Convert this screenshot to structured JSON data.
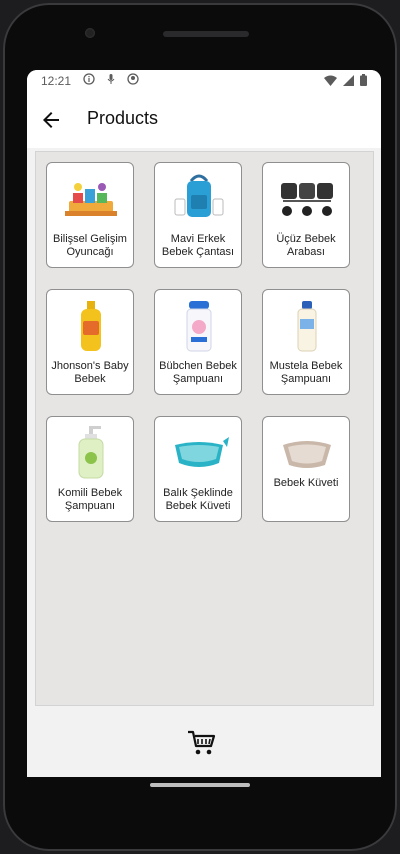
{
  "status": {
    "time": "12:21"
  },
  "appbar": {
    "title": "Products"
  },
  "products": [
    {
      "name": "Bilişsel Gelişim Oyuncağı",
      "icon": "toy-blocks-icon"
    },
    {
      "name": "Mavi Erkek Bebek Çantası",
      "icon": "diaper-bag-icon"
    },
    {
      "name": "Üçüz Bebek Arabası",
      "icon": "triple-stroller-icon"
    },
    {
      "name": "Jhonson's Baby Bebek",
      "icon": "shampoo-bottle-icon"
    },
    {
      "name": "Bübchen Bebek Şampuanı",
      "icon": "shampoo-bottle-icon"
    },
    {
      "name": "Mustela Bebek Şampuanı",
      "icon": "shampoo-bottle-icon"
    },
    {
      "name": "Komili Bebek Şampuanı",
      "icon": "pump-bottle-icon"
    },
    {
      "name": "Balık Şeklinde Bebek Küveti",
      "icon": "fish-bathtub-icon"
    },
    {
      "name": "Bebek Küveti",
      "icon": "baby-bathtub-icon"
    }
  ],
  "colors": {
    "accent": "#2a9fd6",
    "background": "#e6e5e3",
    "cardBorder": "#8f8f8f"
  }
}
